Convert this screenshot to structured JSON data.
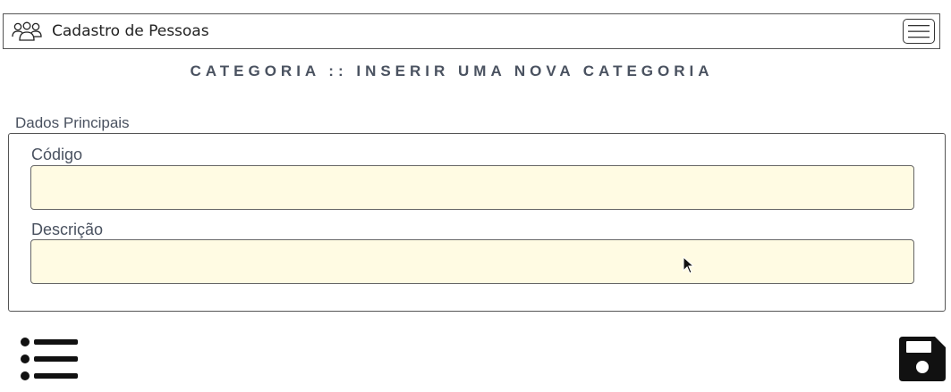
{
  "navbar": {
    "brand_icon": "users-icon",
    "brand": "Cadastro de Pessoas",
    "toggle_icon": "hamburger-menu-icon"
  },
  "page": {
    "title": "CATEGORIA :: INSERIR UMA NOVA CATEGORIA"
  },
  "form": {
    "legend": "Dados Principais",
    "fields": [
      {
        "label": "Código",
        "value": "",
        "placeholder": ""
      },
      {
        "label": "Descrição",
        "value": "",
        "placeholder": ""
      }
    ],
    "input_background": "#fffbe3"
  },
  "actions": {
    "list_icon": "list-icon",
    "save_icon": "floppy-disk-icon"
  },
  "colors": {
    "title": "#4a5260",
    "labels": "#4a5260",
    "icons": "#111111"
  }
}
